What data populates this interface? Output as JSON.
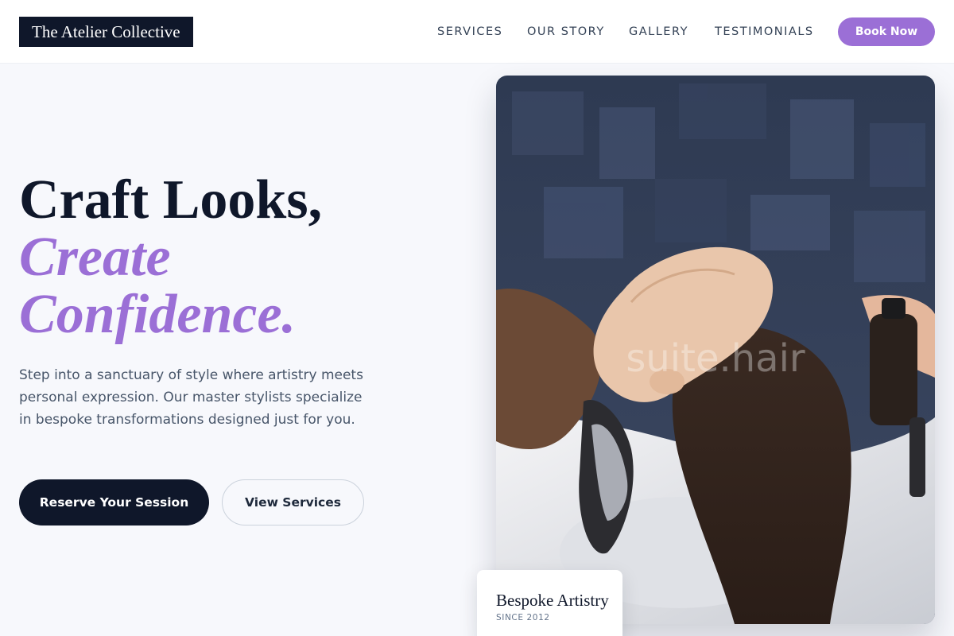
{
  "brand": {
    "name": "The Atelier Collective"
  },
  "nav": {
    "items": [
      {
        "label": "SERVICES"
      },
      {
        "label": "OUR STORY"
      },
      {
        "label": "GALLERY"
      },
      {
        "label": "TESTIMONIALS"
      }
    ],
    "cta_label": "Book Now"
  },
  "hero": {
    "title_line1": "Craft Looks,",
    "title_accent_line1": "Create",
    "title_accent_line2": "Confidence.",
    "description": "Step into a sanctuary of style where artistry meets personal expression. Our master stylists specialize in bespoke transformations designed just for you.",
    "primary_button": "Reserve Your Session",
    "secondary_button": "View Services",
    "image_watermark": "suite.hair"
  },
  "badge": {
    "title": "Bespoke Artistry",
    "subtitle": "SINCE 2012"
  },
  "colors": {
    "accent": "#9b6fd6",
    "dark": "#0f172a",
    "background": "#f7f8fc"
  }
}
